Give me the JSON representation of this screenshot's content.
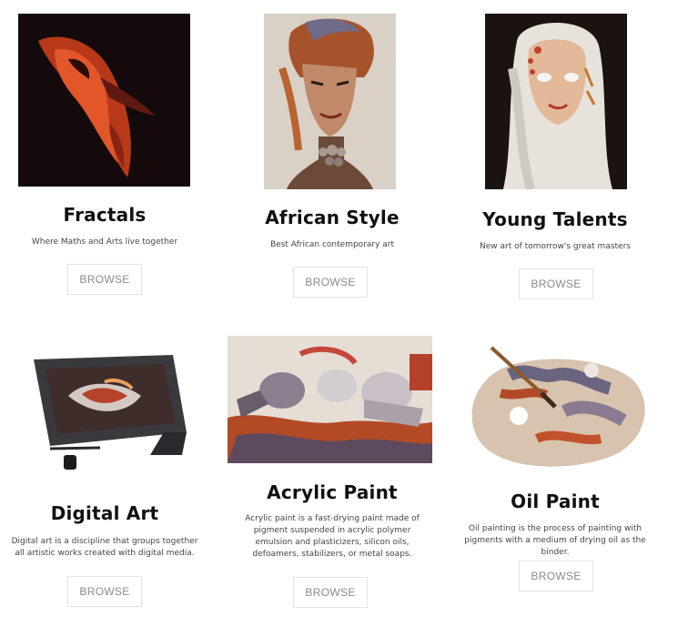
{
  "cards": [
    {
      "title": "Fractals",
      "description": "Where Maths and Arts live together",
      "button": "BROWSE",
      "image": "fractal-art-image"
    },
    {
      "title": "African Style",
      "description": "Best African contemporary art",
      "button": "BROWSE",
      "image": "african-portrait-image"
    },
    {
      "title": "Young Talents",
      "description": "New art of tomorrow's great masters",
      "button": "BROWSE",
      "image": "young-talent-portrait-image"
    },
    {
      "title": "Digital Art",
      "description": "Digital art is a discipline that groups together all artistic works created with digital media.",
      "button": "BROWSE",
      "image": "drawing-tablet-image"
    },
    {
      "title": "Acrylic Paint",
      "description": "Acrylic paint is a fast-drying paint made of pigment suspended in acrylic polymer emulsion and plasticizers, silicon oils, defoamers, stabilizers, or metal soaps.",
      "button": "BROWSE",
      "image": "acrylic-paint-tubes-image"
    },
    {
      "title": "Oil Paint",
      "description": "Oil painting is the process of painting with pigments with a medium of drying oil as the binder.",
      "button": "BROWSE",
      "image": "oil-palette-image"
    }
  ],
  "colors": {
    "title": "#111111",
    "button_text": "#8a8a8a",
    "button_border": "#e4e4e4"
  }
}
